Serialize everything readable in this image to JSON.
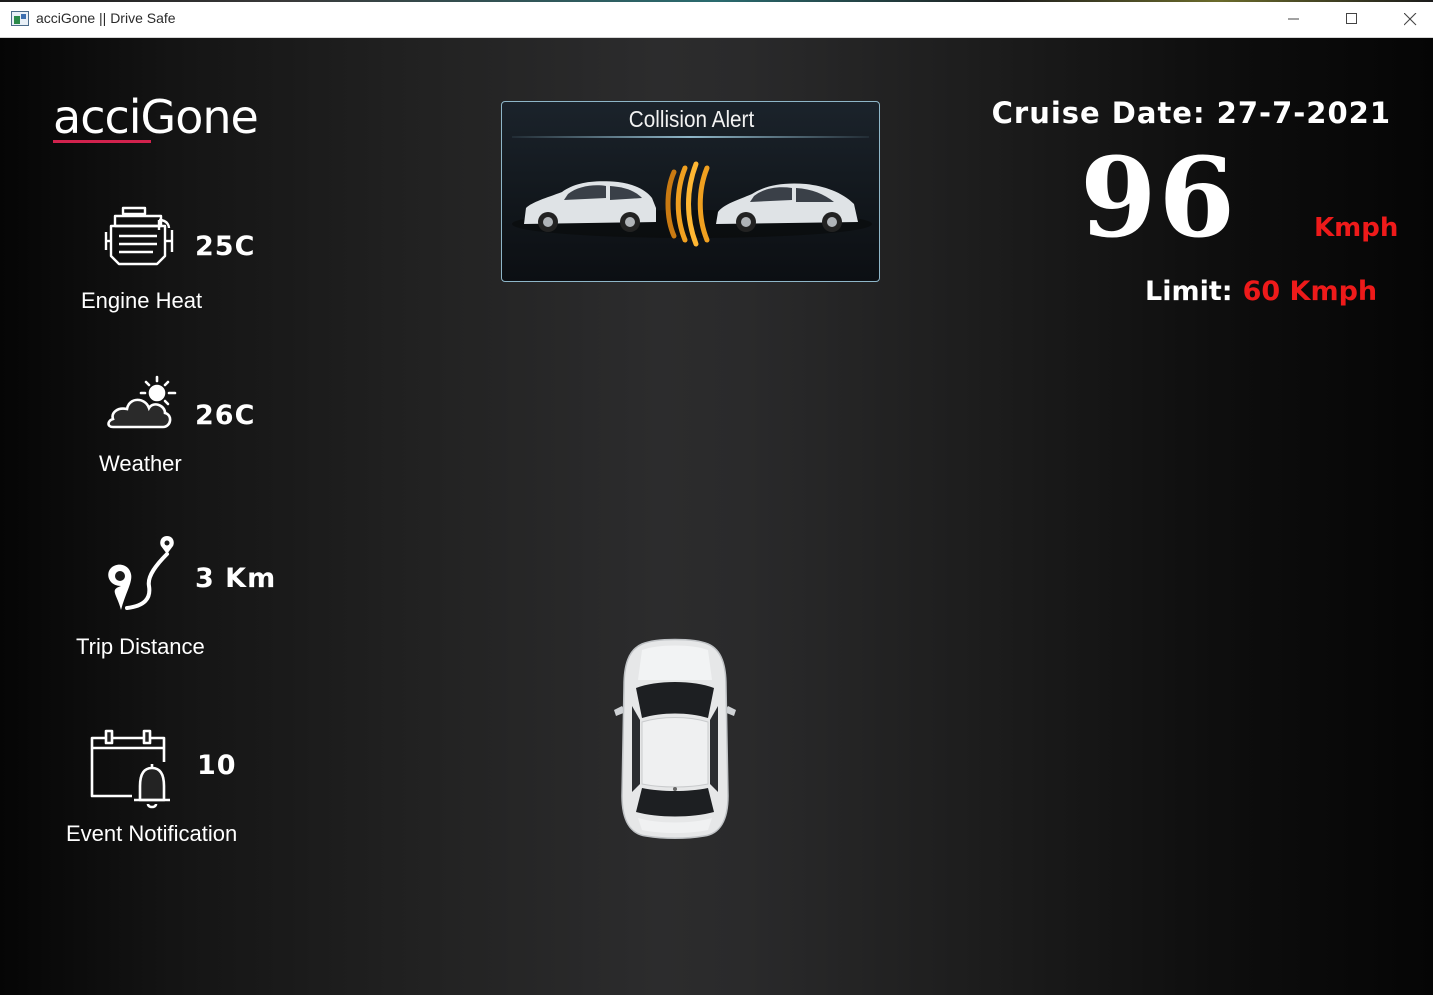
{
  "window": {
    "title": "acciGone || Drive Safe",
    "controls": [
      "minimize",
      "maximize",
      "close"
    ]
  },
  "brand": {
    "logo_text": "acciGone",
    "accent_color": "#d1224d"
  },
  "stats": [
    {
      "icon": "engine-icon",
      "value": "25C",
      "label": "Engine Heat"
    },
    {
      "icon": "weather-icon",
      "value": "26C",
      "label": "Weather"
    },
    {
      "icon": "route-icon",
      "value": "3 Km",
      "label": "Trip Distance"
    },
    {
      "icon": "calendar-bell-icon",
      "value": "10",
      "label": "Event Notification"
    }
  ],
  "alert": {
    "title": "Collision Alert",
    "wave_color": "#f0a020"
  },
  "cruise": {
    "date_label": "Cruise Date: 27-7-2021",
    "speed": "96",
    "unit": "Kmph",
    "limit_label": "Limit:",
    "limit_value": "60 Kmph",
    "warning_color": "#ee1a1a"
  }
}
